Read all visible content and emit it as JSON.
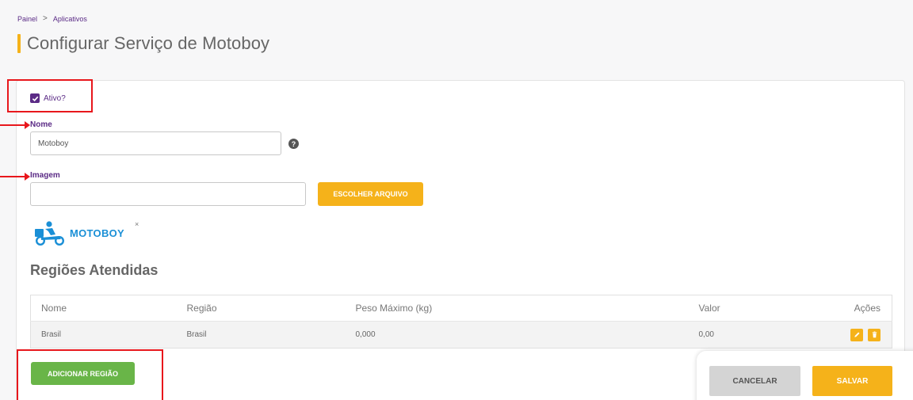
{
  "breadcrumb": {
    "home": "Painel",
    "separator": ">",
    "current": "Aplicativos"
  },
  "page": {
    "title": "Configurar Serviço de Motoboy"
  },
  "form": {
    "active_label": "Ativo?",
    "active_checked": true,
    "name_label": "Nome",
    "name_value": "Motoboy",
    "help_icon": "?",
    "image_label": "Imagem",
    "image_value": "",
    "choose_file_button": "ESCOLHER ARQUIVO",
    "logo_text": "MOTOBOY",
    "remove_image": "×"
  },
  "regions": {
    "title": "Regiões Atendidas",
    "columns": [
      "Nome",
      "Região",
      "Peso Máximo (kg)",
      "Valor",
      "Ações"
    ],
    "rows": [
      {
        "nome": "Brasil",
        "regiao": "Brasil",
        "peso": "0,000",
        "valor": "0,00"
      }
    ],
    "add_button": "ADICIONAR REGIÃO"
  },
  "footer": {
    "cancel_button": "CANCELAR",
    "save_button": "SALVAR"
  },
  "colors": {
    "accent": "#f5b21a",
    "purple": "#5b2b86",
    "green": "#69b548",
    "annotation_red": "#e8171c",
    "logo_blue": "#1a8fd6"
  }
}
